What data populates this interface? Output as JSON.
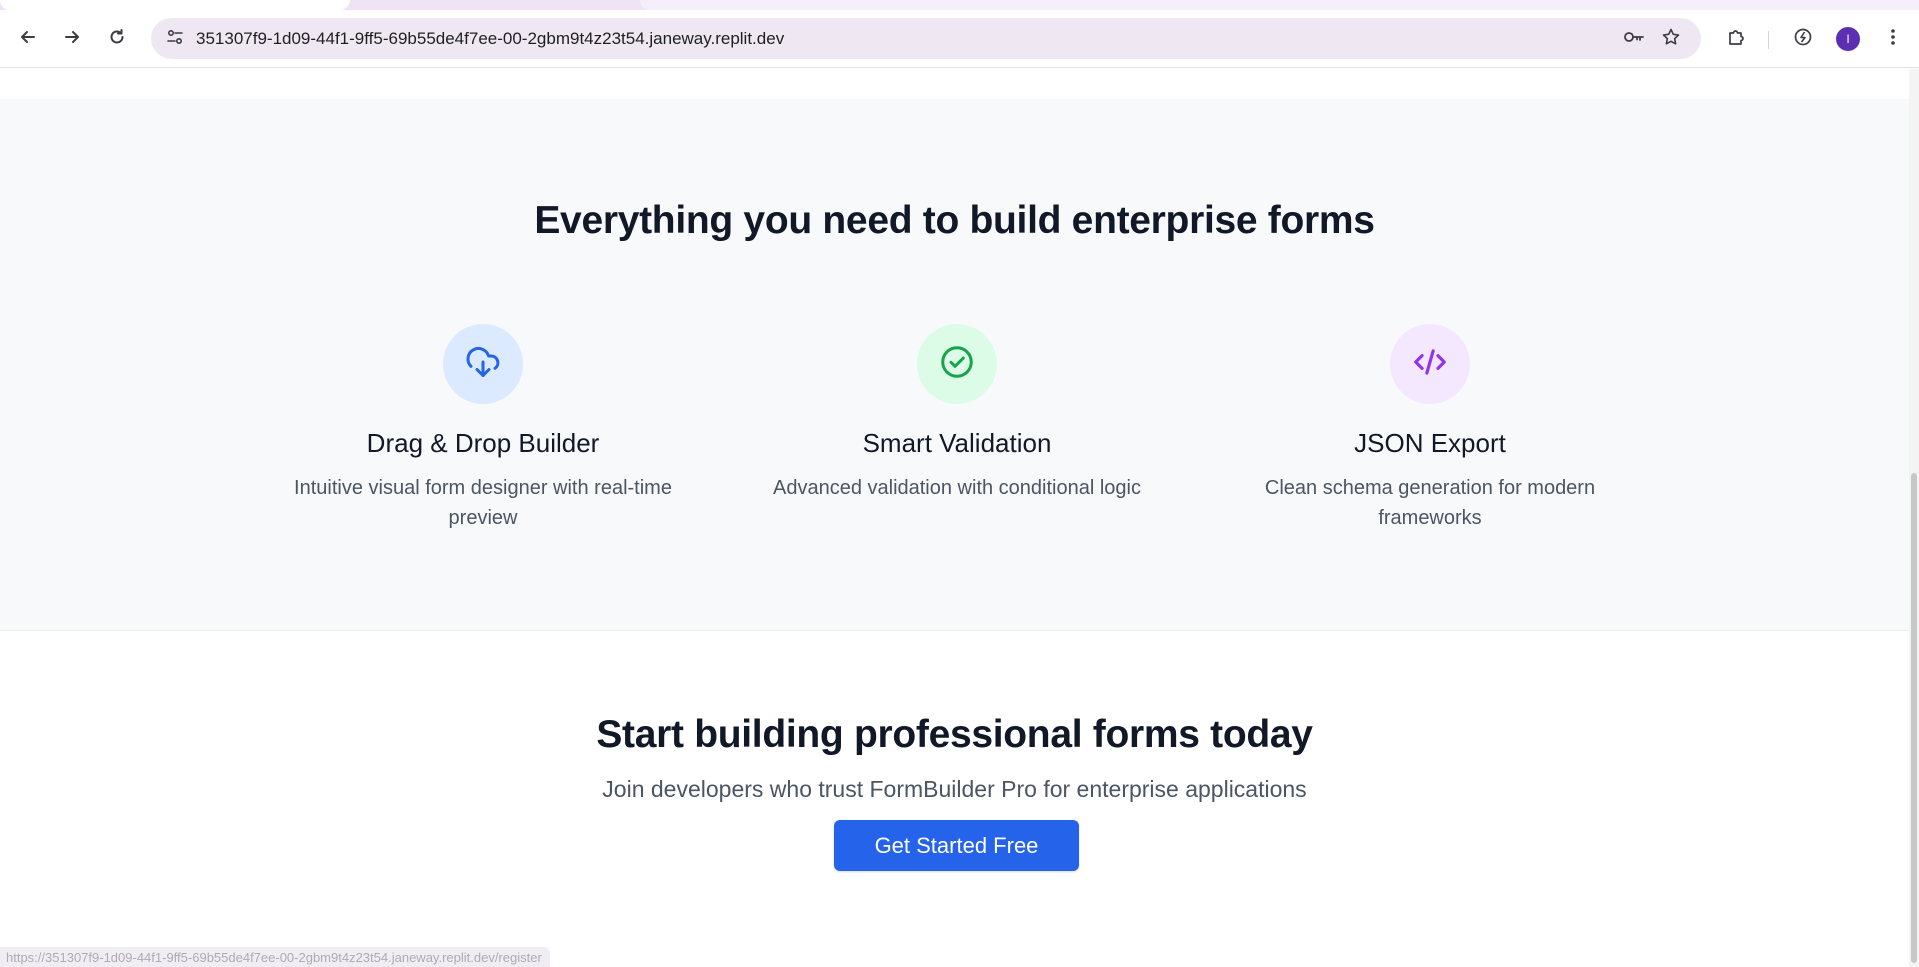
{
  "browser": {
    "url": "351307f9-1d09-44f1-9ff5-69b55de4f7ee-00-2gbm9t4z23t54.janeway.replit.dev",
    "status_url": "https://351307f9-1d09-44f1-9ff5-69b55de4f7ee-00-2gbm9t4z23t54.janeway.replit.dev/register",
    "profile_initial": "I",
    "profile_color": "#5b2fb0"
  },
  "features": {
    "title": "Everything you need to build enterprise forms",
    "items": [
      {
        "icon": "cloud-download-icon",
        "title": "Drag & Drop Builder",
        "description": "Intuitive visual form designer with real-time preview",
        "icon_bg": "#dbeafe",
        "icon_color": "#2563eb"
      },
      {
        "icon": "check-circle-icon",
        "title": "Smart Validation",
        "description": "Advanced validation with conditional logic",
        "icon_bg": "#dcfce7",
        "icon_color": "#16a34a"
      },
      {
        "icon": "code-icon",
        "title": "JSON Export",
        "description": "Clean schema generation for modern frameworks",
        "icon_bg": "#f3e8ff",
        "icon_color": "#9333ea"
      }
    ]
  },
  "cta": {
    "title": "Start building professional forms today",
    "subtitle": "Join developers who trust FormBuilder Pro for enterprise applications",
    "button_label": "Get Started Free",
    "button_color": "#2563eb"
  }
}
